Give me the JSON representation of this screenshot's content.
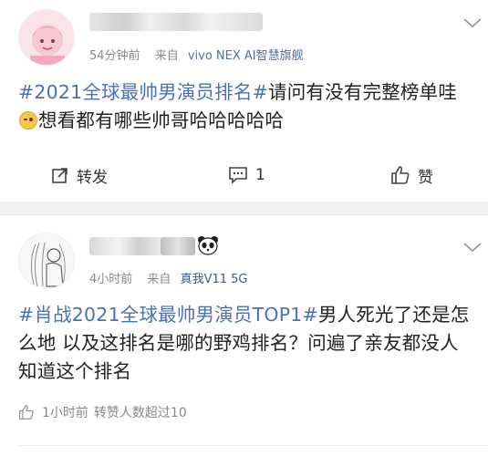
{
  "posts": [
    {
      "time": "54分钟前",
      "source_prefix": "来自",
      "device": "vivo NEX AI智慧旗舰",
      "topic": "#2021全球最帅男演员排名#",
      "text_before_emoji": "请问有没有完整榜单哇",
      "text_after_emoji": "想看都有哪些帅哥哈哈哈哈哈",
      "actions": {
        "repost_label": "转发",
        "comment_count": "1",
        "like_label": "赞"
      }
    },
    {
      "time": "4小时前",
      "source_prefix": "来自",
      "device": "真我V11 5G",
      "topic": "#肖战2021全球最帅男演员TOP1#",
      "text": "男人死光了还是怎么地 以及这排名是哪的野鸡排名？问遍了亲友都没人知道这个排名",
      "stat_time": "1小时前",
      "stat_text": "转赞人数超过10"
    }
  ],
  "icons": {
    "chevron": "chevron-down-icon",
    "repost": "share-icon",
    "comment": "comment-icon",
    "like": "thumbs-up-icon",
    "stat": "thumbs-up-icon",
    "emoji": "smile-emoji-icon",
    "panda": "panda-icon"
  },
  "colors": {
    "topic": "#4a70b8",
    "meta": "#8a8a8a",
    "separator": "#f2f2f2"
  }
}
